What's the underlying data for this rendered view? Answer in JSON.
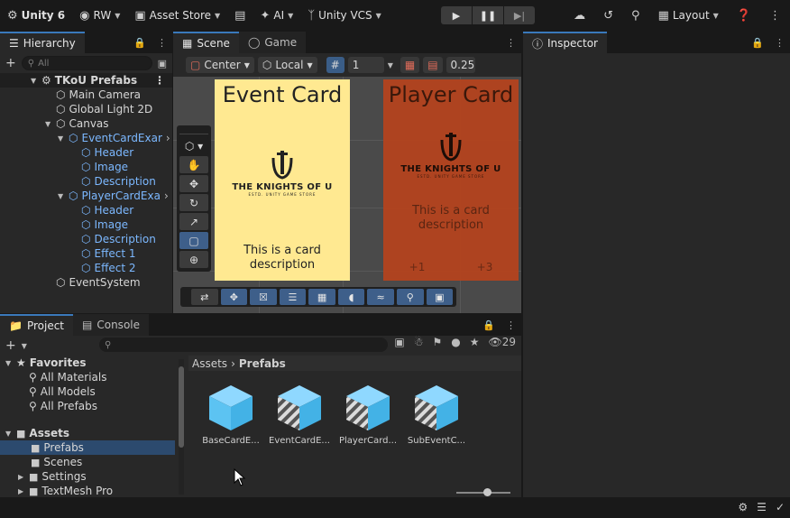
{
  "topbar": {
    "unity_label": "Unity 6",
    "account": "RW",
    "asset_store": "Asset Store",
    "ai": "AI",
    "vcs": "Unity VCS",
    "layout": "Layout"
  },
  "hierarchy": {
    "tab": "Hierarchy",
    "search_placeholder": "All",
    "scene_name": "TKoU Prefabs",
    "items": [
      {
        "label": "Main Camera"
      },
      {
        "label": "Global Light 2D"
      },
      {
        "label": "Canvas"
      },
      {
        "label": "EventCardExar"
      },
      {
        "label": "Header"
      },
      {
        "label": "Image"
      },
      {
        "label": "Description"
      },
      {
        "label": "PlayerCardExa"
      },
      {
        "label": "Header"
      },
      {
        "label": "Image"
      },
      {
        "label": "Description"
      },
      {
        "label": "Effect 1"
      },
      {
        "label": "Effect 2"
      },
      {
        "label": "EventSystem"
      }
    ]
  },
  "scene": {
    "tab_scene": "Scene",
    "tab_game": "Game",
    "pivot": "Center",
    "space": "Local",
    "grid_value": "1",
    "snap_value": "0.25",
    "event_card": {
      "title": "Event Card",
      "logo_name": "THE KNIGHTS OF U",
      "logo_sub": "ESTD. UNITY GAME STORE",
      "description": "This is a card description"
    },
    "player_card": {
      "title": "Player Card",
      "logo_name": "THE KNIGHTS OF U",
      "logo_sub": "ESTD. UNITY GAME STORE",
      "description": "This is a card description",
      "stat_left": "+1",
      "stat_right": "+3"
    }
  },
  "inspector": {
    "tab": "Inspector"
  },
  "project": {
    "tab_project": "Project",
    "tab_console": "Console",
    "visible_count": "29",
    "favorites_label": "Favorites",
    "favorites": [
      "All Materials",
      "All Models",
      "All Prefabs"
    ],
    "assets_label": "Assets",
    "folders": [
      "Prefabs",
      "Scenes",
      "Settings",
      "TextMesh Pro"
    ],
    "breadcrumb_root": "Assets",
    "breadcrumb_current": "Prefabs",
    "assets": [
      {
        "label": "BaseCardE..."
      },
      {
        "label": "EventCardE..."
      },
      {
        "label": "PlayerCard..."
      },
      {
        "label": "SubEventC..."
      }
    ]
  },
  "colors": {
    "accent": "#3a79bb",
    "event_card": "#ffe991",
    "player_card": "#b4431e",
    "prefab_text": "#7cb8ff"
  }
}
